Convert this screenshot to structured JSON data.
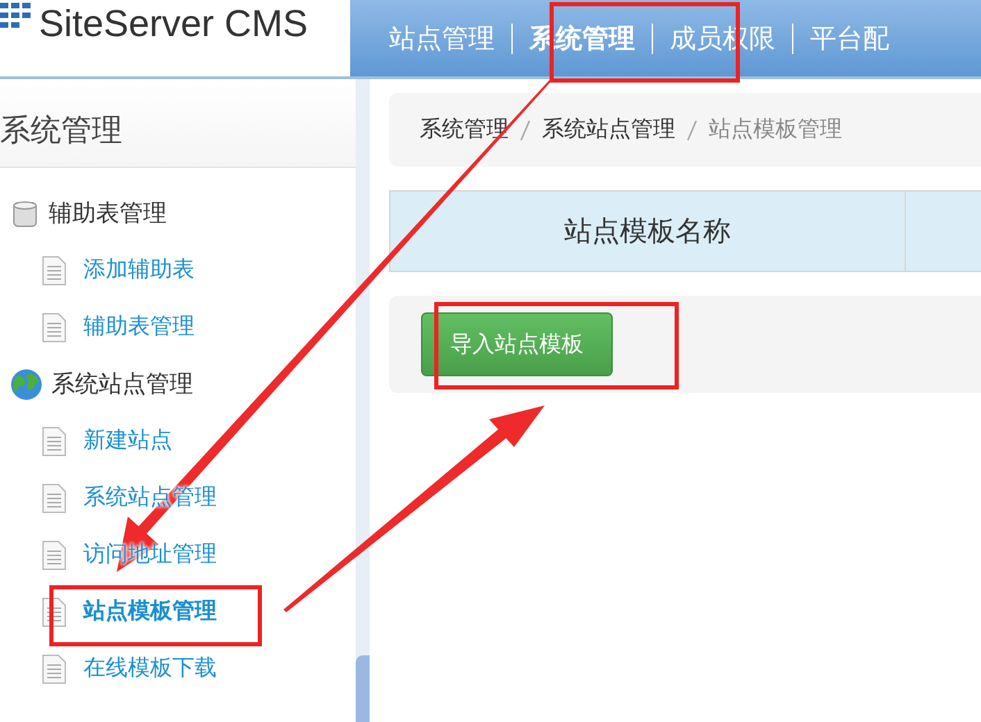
{
  "header": {
    "logo": "SiteServer CMS",
    "nav": [
      {
        "label": "站点管理",
        "selected": false
      },
      {
        "label": "系统管理",
        "selected": true
      },
      {
        "label": "成员权限",
        "selected": false
      },
      {
        "label": "平台配",
        "selected": false
      }
    ]
  },
  "sidebar": {
    "title": "系统管理",
    "groups": [
      {
        "label": "辅助表管理",
        "kind": "database",
        "children": [
          {
            "label": "添加辅助表",
            "selected": false
          },
          {
            "label": "辅助表管理",
            "selected": false
          }
        ]
      },
      {
        "label": "系统站点管理",
        "kind": "globe",
        "children": [
          {
            "label": "新建站点",
            "selected": false
          },
          {
            "label": "系统站点管理",
            "selected": false
          },
          {
            "label": "访问地址管理",
            "selected": false
          },
          {
            "label": "站点模板管理",
            "selected": true
          },
          {
            "label": "在线模板下载",
            "selected": false
          }
        ]
      }
    ]
  },
  "breadcrumb": [
    {
      "label": "系统管理",
      "current": false
    },
    {
      "label": "系统站点管理",
      "current": false
    },
    {
      "label": "站点模板管理",
      "current": true
    }
  ],
  "table": {
    "columns": [
      "站点模板名称"
    ]
  },
  "import_button": "导入站点模板"
}
